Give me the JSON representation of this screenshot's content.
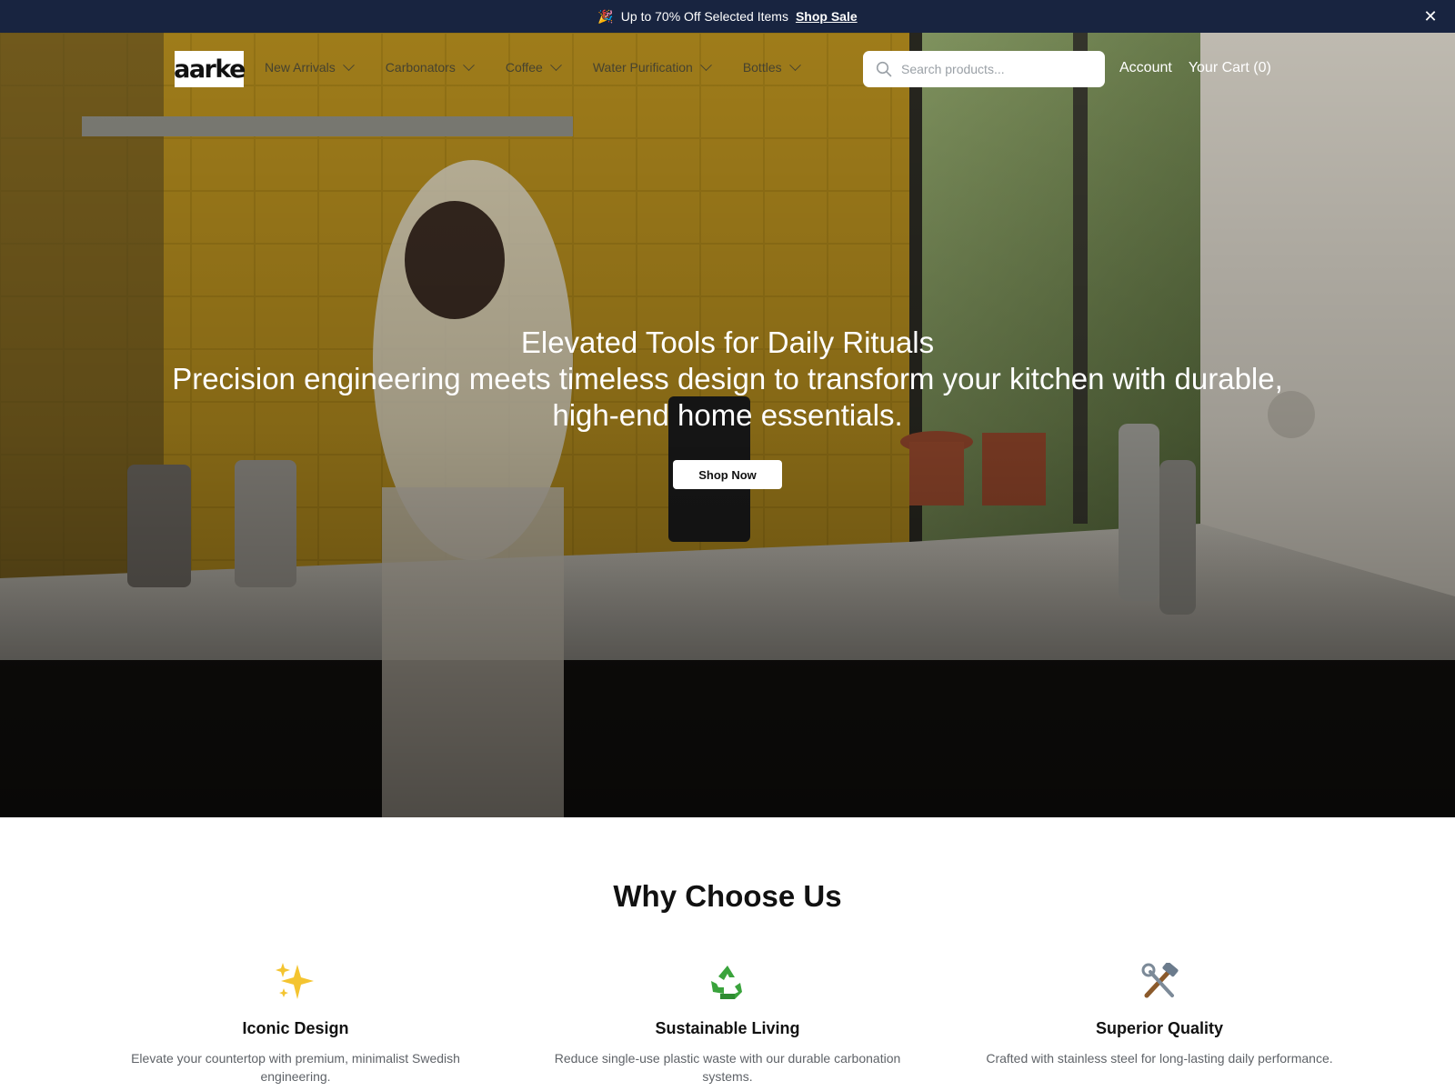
{
  "announcement": {
    "emoji": "🎉",
    "text": "Up to 70% Off Selected Items",
    "link_label": "Shop Sale",
    "close_glyph": "✕"
  },
  "header": {
    "logo_text": "aarke",
    "menu": [
      {
        "label": "New Arrivals"
      },
      {
        "label": "Carbonators"
      },
      {
        "label": "Coffee"
      },
      {
        "label": "Water Purification"
      },
      {
        "label": "Bottles"
      }
    ],
    "search_placeholder": "Search products...",
    "account_label": "Account",
    "cart_label": "Your Cart (0)"
  },
  "hero": {
    "title": "Elevated Tools for Daily Rituals",
    "subtitle": "Precision engineering meets timeless design to transform your kitchen with durable, high-end home essentials.",
    "cta_label": "Shop Now"
  },
  "why": {
    "title": "Why Choose Us",
    "features": [
      {
        "icon": "sparkles-icon",
        "title": "Iconic Design",
        "description": "Elevate your countertop with premium, minimalist Swedish engineering."
      },
      {
        "icon": "recycle-icon",
        "title": "Sustainable Living",
        "description": "Reduce single-use plastic waste with our durable carbonation systems."
      },
      {
        "icon": "tools-icon",
        "title": "Superior Quality",
        "description": "Crafted with stainless steel for long-lasting daily performance."
      }
    ]
  },
  "colors": {
    "announcement_bg": "#182440",
    "accent_tile": "#b8901c"
  }
}
